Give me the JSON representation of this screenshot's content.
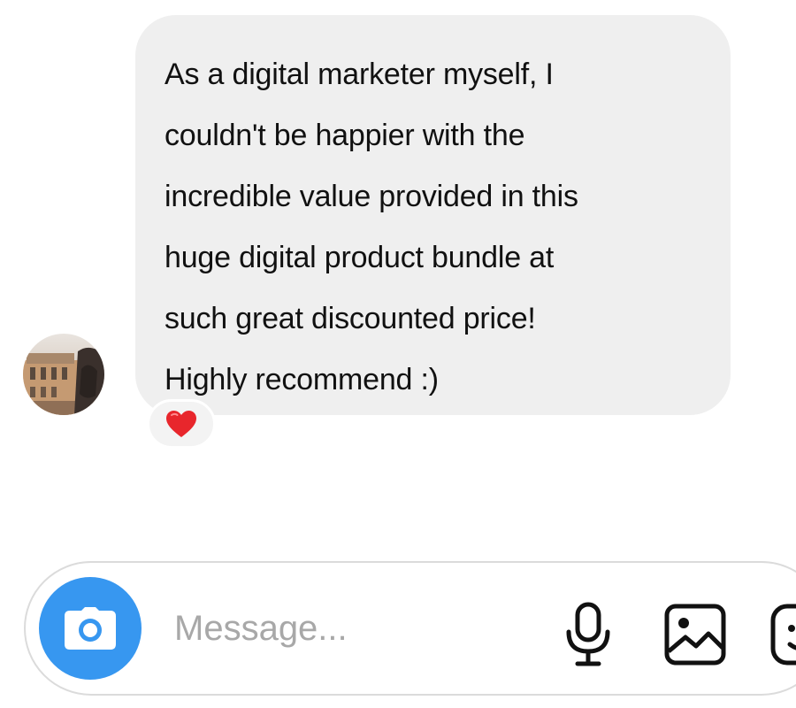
{
  "message": {
    "text": "As a digital marketer myself, I\ncouldn't be happier with the\nincredible value provided in this\nhuge digital product bundle at\nsuch great discounted price!\nHighly recommend :)",
    "reaction_icon": "red-heart-icon",
    "bubble_color": "#efefef"
  },
  "avatar": {
    "icon": "profile-photo-avatar"
  },
  "composer": {
    "placeholder": "Message...",
    "value": "",
    "camera_icon": "camera-icon",
    "camera_color": "#3797f0",
    "tools": [
      "microphone-icon",
      "gallery-icon",
      "emoji-icon"
    ]
  }
}
